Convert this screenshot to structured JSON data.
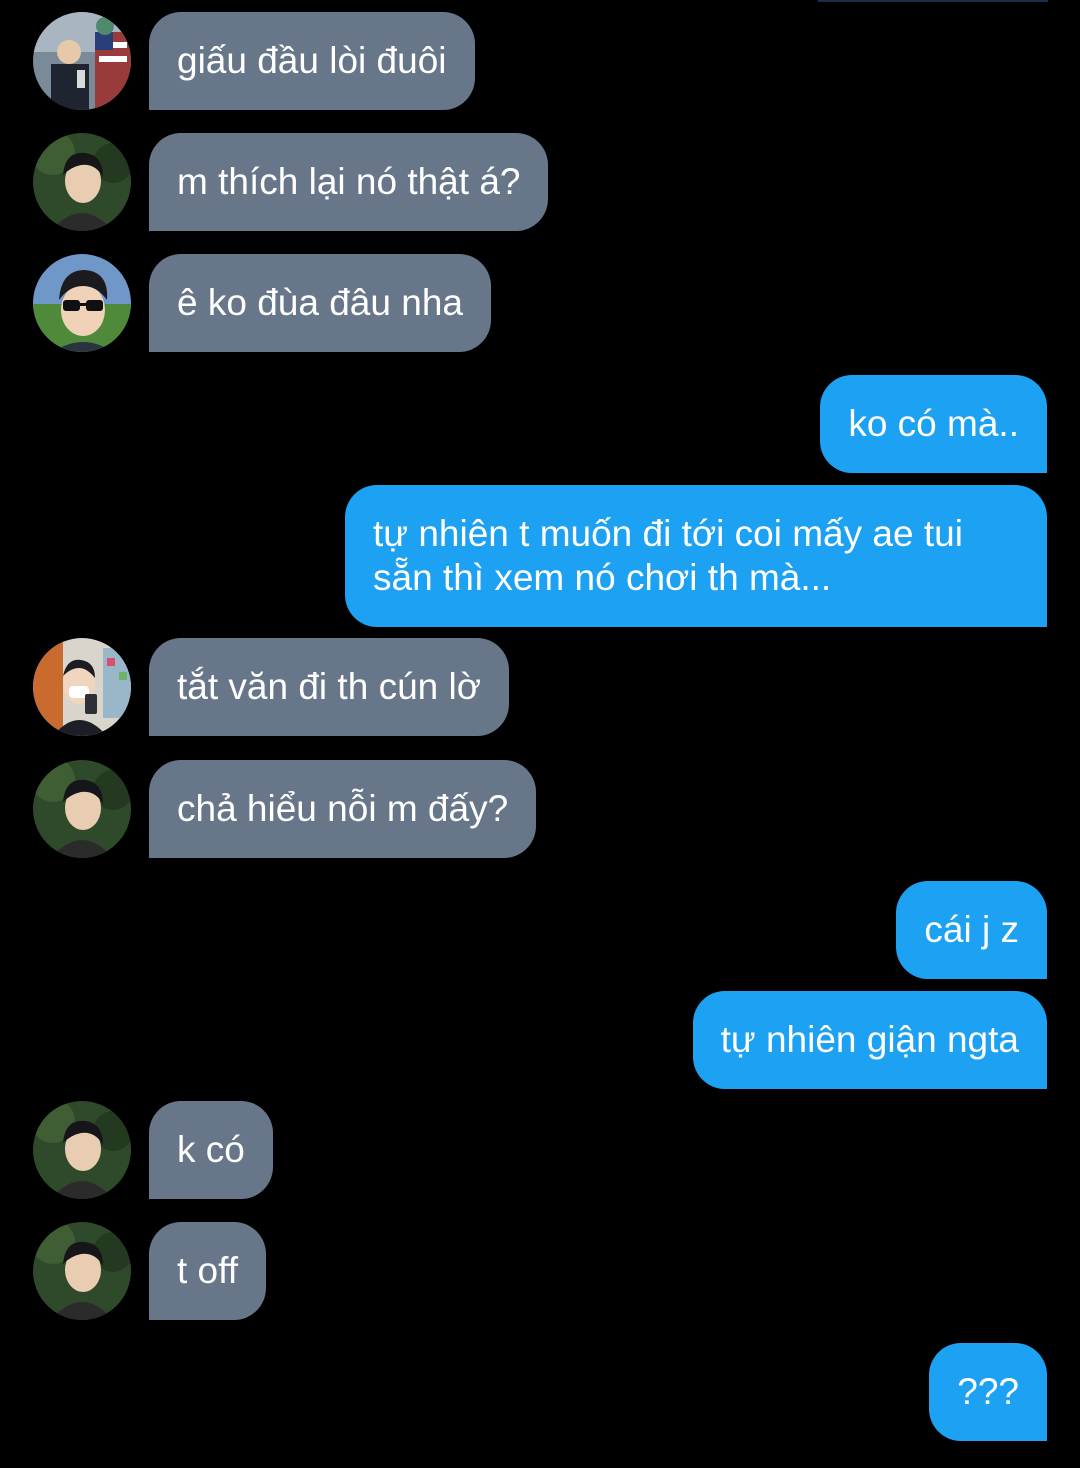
{
  "messages": [
    {
      "side": "recv",
      "text": "giấu đầu lòi đuôi",
      "avatar": "avatar-statue-of-liberty"
    },
    {
      "side": "recv",
      "text": "m thích lại nó thật á?",
      "avatar": "avatar-boy-portrait"
    },
    {
      "side": "recv",
      "text": "ê ko đùa đâu nha",
      "avatar": "avatar-sunglasses"
    },
    {
      "side": "sent",
      "text": "ko có mà.."
    },
    {
      "side": "sent",
      "text": "tự nhiên t muốn đi tới coi mấy ae tui sẵn thì xem nó chơi th mà..."
    },
    {
      "side": "recv",
      "text": "tắt văn đi th cún lờ",
      "avatar": "avatar-mirror-selfie"
    },
    {
      "side": "recv",
      "text": "chả hiểu nỗi m đấy?",
      "avatar": "avatar-boy-portrait"
    },
    {
      "side": "sent",
      "text": "cái j z"
    },
    {
      "side": "sent",
      "text": "tự nhiên giận ngta"
    },
    {
      "side": "recv",
      "text": "k có",
      "avatar": "avatar-boy-portrait"
    },
    {
      "side": "recv",
      "text": "t off",
      "avatar": "avatar-boy-portrait"
    },
    {
      "side": "sent",
      "text": "???"
    }
  ],
  "colors": {
    "background": "#000000",
    "received_bubble": "#677789",
    "sent_bubble": "#1DA1F2",
    "text": "#FFFFFF"
  }
}
